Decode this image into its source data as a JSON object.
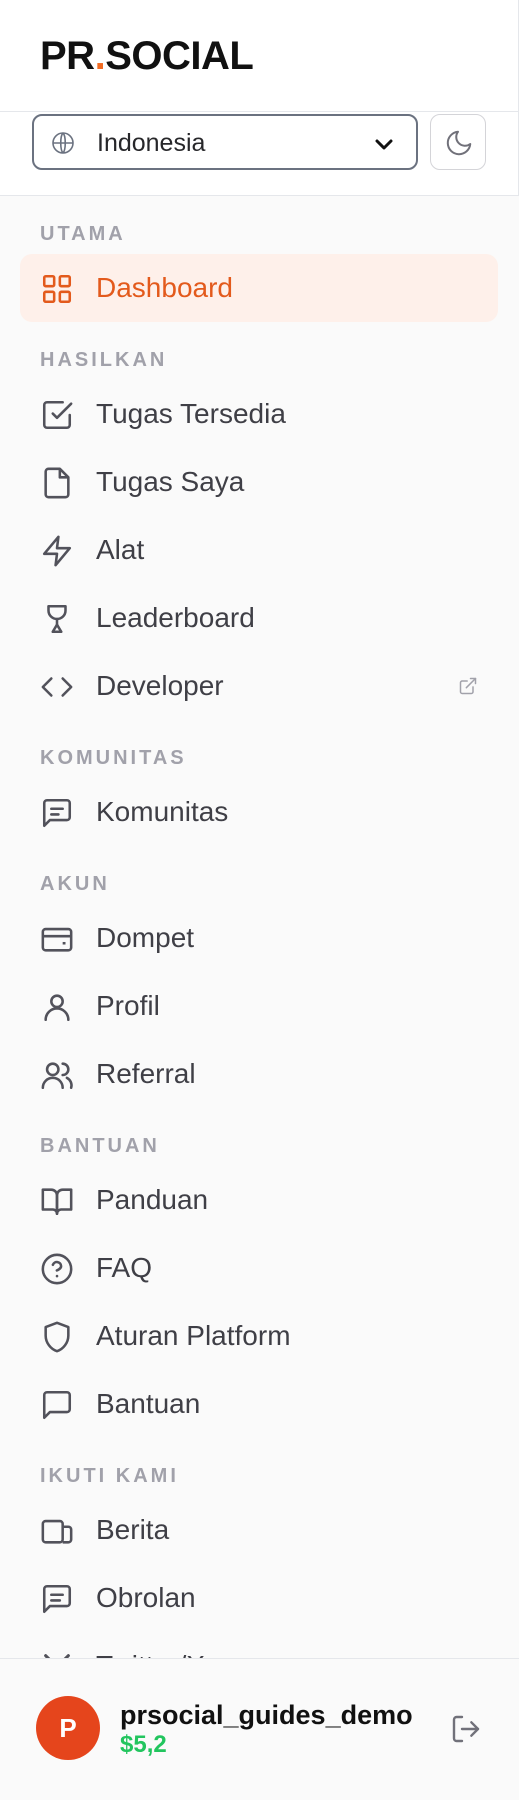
{
  "brand": {
    "part1": "PR",
    "dot": ".",
    "part2": "SOCIAL",
    "accent_color": "#f26a21"
  },
  "language": {
    "selected": "Indonesia"
  },
  "sections": {
    "utama": {
      "title": "UTAMA",
      "items": [
        {
          "label": "Dashboard",
          "icon": "dashboard-grid-icon",
          "active": true
        }
      ]
    },
    "hasilkan": {
      "title": "HASILKAN",
      "items": [
        {
          "label": "Tugas Tersedia",
          "icon": "checkbox-icon"
        },
        {
          "label": "Tugas Saya",
          "icon": "file-icon"
        },
        {
          "label": "Alat",
          "icon": "lightning-icon"
        },
        {
          "label": "Leaderboard",
          "icon": "trophy-icon"
        },
        {
          "label": "Developer",
          "icon": "code-icon",
          "external": true
        }
      ]
    },
    "komunitas": {
      "title": "KOMUNITAS",
      "items": [
        {
          "label": "Komunitas",
          "icon": "message-square-icon"
        }
      ]
    },
    "akun": {
      "title": "AKUN",
      "items": [
        {
          "label": "Dompet",
          "icon": "wallet-icon"
        },
        {
          "label": "Profil",
          "icon": "user-icon"
        },
        {
          "label": "Referral",
          "icon": "users-icon"
        }
      ]
    },
    "bantuan": {
      "title": "BANTUAN",
      "items": [
        {
          "label": "Panduan",
          "icon": "book-icon"
        },
        {
          "label": "FAQ",
          "icon": "help-circle-icon"
        },
        {
          "label": "Aturan Platform",
          "icon": "shield-icon"
        },
        {
          "label": "Bantuan",
          "icon": "chat-bubble-icon"
        }
      ]
    },
    "ikuti": {
      "title": "IKUTI KAMI",
      "items": [
        {
          "label": "Berita",
          "icon": "news-icon"
        },
        {
          "label": "Obrolan",
          "icon": "chat-lines-icon"
        },
        {
          "label": "Twitter/X",
          "icon": "x-logo-icon"
        }
      ]
    }
  },
  "user": {
    "initial": "P",
    "name": "prsocial_guides_demo",
    "balance": "$5,2",
    "balance_color": "#22c55e"
  }
}
